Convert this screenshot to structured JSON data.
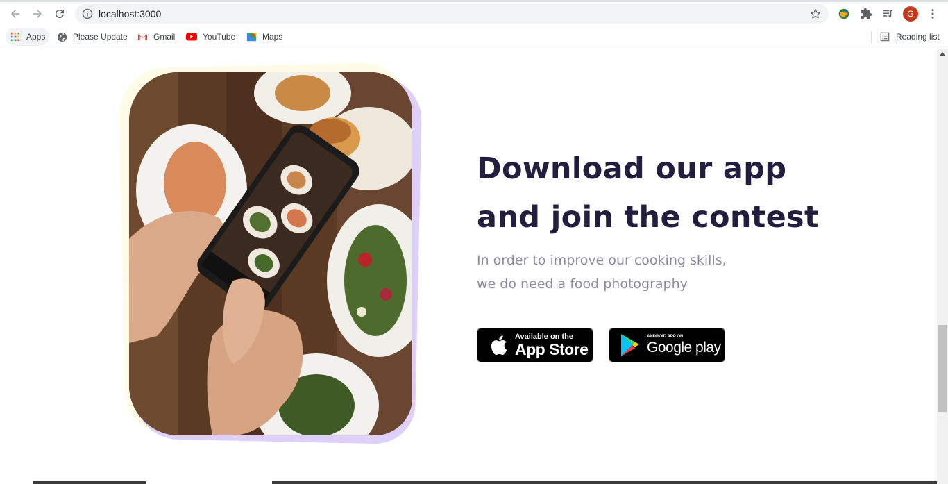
{
  "browser": {
    "url": "localhost:3000",
    "avatar_letter": "G",
    "bookmarks": [
      {
        "label": "Apps",
        "icon": "apps-grid-icon"
      },
      {
        "label": "Please Update",
        "icon": "globe-icon"
      },
      {
        "label": "Gmail",
        "icon": "gmail-icon"
      },
      {
        "label": "YouTube",
        "icon": "youtube-icon"
      },
      {
        "label": "Maps",
        "icon": "maps-icon"
      }
    ],
    "reading_list": "Reading list"
  },
  "hero": {
    "title_line1": "Download our app",
    "title_line2": "and join the contest",
    "subtitle_line1": "In order to improve our cooking skills,",
    "subtitle_line2": "we do need a food photography",
    "app_store": {
      "small": "Available on the",
      "big": "App Store"
    },
    "google_play": {
      "small": "ANDROID APP ON",
      "big": "Google play"
    }
  },
  "colors": {
    "title": "#231d3e",
    "subtitle": "#8e8aa6",
    "frame_yellow": "#fffbe6",
    "frame_purple": "#ddd0fb"
  }
}
